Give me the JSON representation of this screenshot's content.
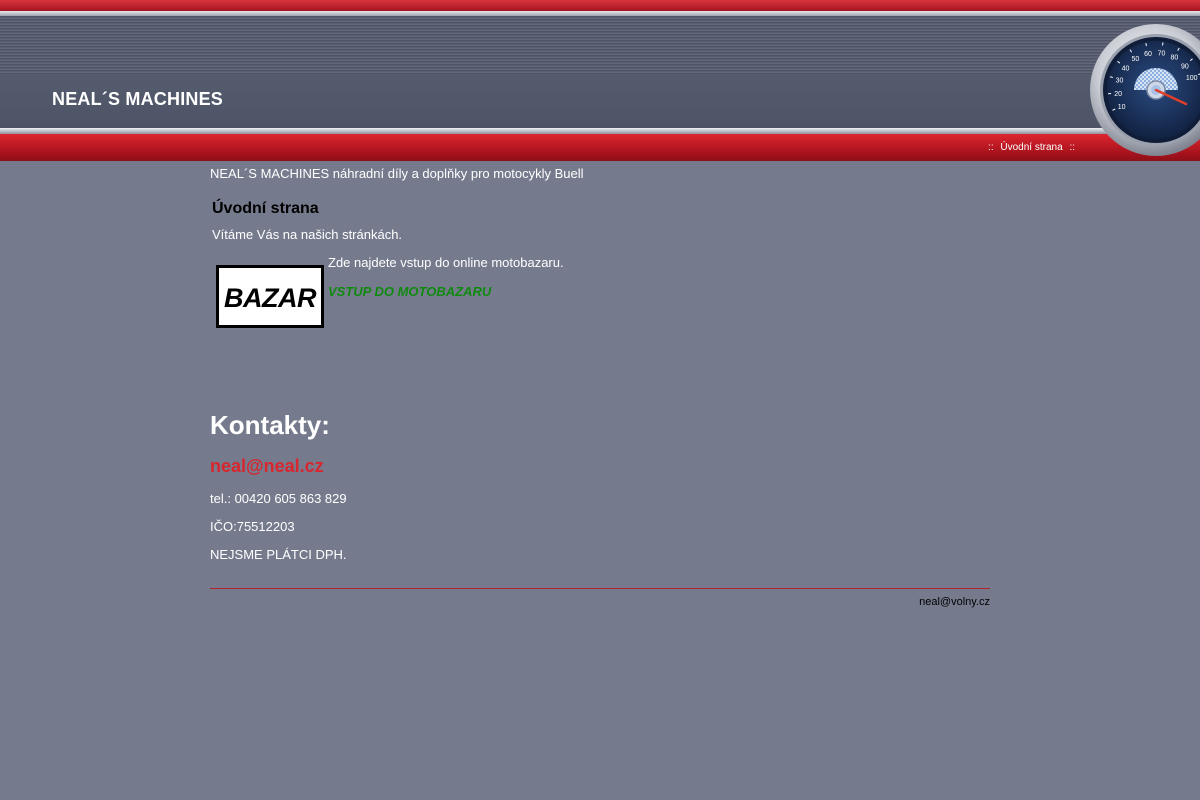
{
  "header": {
    "site_title": "NEAL´S MACHINES"
  },
  "nav": {
    "separator": "::",
    "home_label": "Úvodní strana"
  },
  "gauge": {
    "ticks": [
      "10",
      "20",
      "30",
      "40",
      "50",
      "60",
      "70",
      "80",
      "90",
      "100"
    ],
    "needle_color": "#e0402a",
    "face_color": "#1d3560"
  },
  "content": {
    "tagline": "NEAL´S MACHINES náhradní díly a doplňky pro motocykly Buell",
    "section_title": "Úvodní strana",
    "welcome": "Vítáme Vás na našich stránkách.",
    "intro": "Zde najdete vstup do online motobazaru.",
    "bazar_link": "VSTUP DO MOTOBAZARU",
    "bazar_logo_text": "BAZAR"
  },
  "contacts": {
    "title": "Kontakty:",
    "email": "neal@neal.cz",
    "phone": "tel.: 00420 605 863 829",
    "ico": "IČO:75512203",
    "vat_note": "NEJSME PLÁTCI DPH."
  },
  "footer": {
    "email": "neal@volny.cz"
  },
  "colors": {
    "background": "#757b8d",
    "accent_red": "#c11b25",
    "link_green": "#0f8a0f",
    "email_red": "#d8262e"
  }
}
